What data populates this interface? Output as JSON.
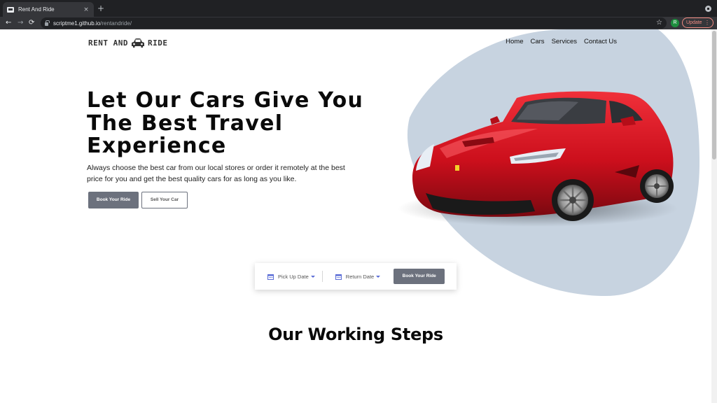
{
  "browser": {
    "tab_title": "Rent And Ride",
    "tab_close": "×",
    "new_tab": "+",
    "back": "←",
    "forward": "→",
    "reload": "⟳",
    "url_host": "scriptme1.github.io",
    "url_path": "/rentandride/",
    "star": "☆",
    "profile_initial": "R",
    "update_label": "Update",
    "menu_dots": "⋮"
  },
  "header": {
    "logo_left": "RENT AND",
    "logo_right": "RIDE",
    "nav": [
      "Home",
      "Cars",
      "Services",
      "Contact Us"
    ]
  },
  "hero": {
    "title": "Let Our Cars Give You The Best Travel Experience",
    "description": "Always choose the best car from our local stores or order it remotely at the best price for you and get the best quality cars for as long as you like.",
    "primary_button": "Book Your Ride",
    "secondary_button": "Sell Your Car"
  },
  "booking": {
    "pickup_label": "Pick Up Date",
    "return_label": "Return Date",
    "button": "Book Your Ride"
  },
  "section": {
    "title": "Our Working Steps"
  },
  "colors": {
    "blob": "#c7d3e0",
    "button_gray": "#6c717d",
    "car_red": "#d0101e",
    "calendar_blue": "#5a6cd6"
  }
}
